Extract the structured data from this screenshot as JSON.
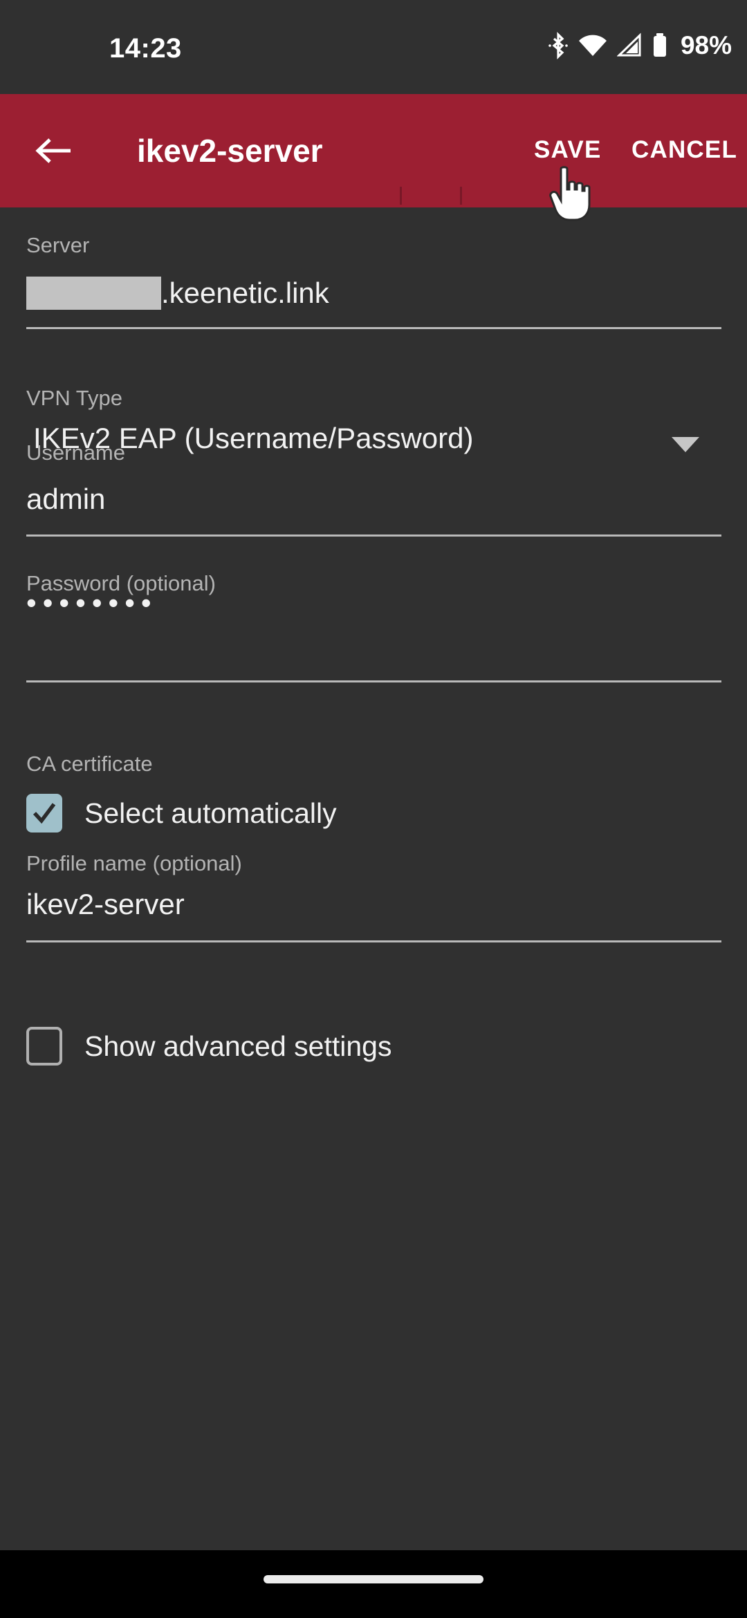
{
  "statusbar": {
    "time": "14:23",
    "battery_percent": "98%",
    "icons": [
      "bluetooth-icon",
      "wifi-icon",
      "cellular-signal-icon",
      "battery-icon"
    ]
  },
  "appbar": {
    "back_icon": "back-arrow-icon",
    "title": "ikev2-server",
    "save_label": "SAVE",
    "cancel_label": "CANCEL",
    "background_color": "#9c1f32",
    "text_color": "#ffffff"
  },
  "form": {
    "server": {
      "label": "Server",
      "redacted": true,
      "value_suffix": ".keenetic.link"
    },
    "vpn_type": {
      "label": "VPN Type",
      "value": "IKEv2 EAP (Username/Password)",
      "caret_icon": "chevron-down-icon"
    },
    "username": {
      "label": "Username",
      "value": "admin"
    },
    "password": {
      "label": "Password (optional)",
      "value": "••••••••",
      "masked": true
    },
    "ca_certificate": {
      "label": "CA certificate",
      "checkbox_label": "Select automatically",
      "checked": true,
      "checkbox_color": "#9fc0ca"
    },
    "profile_name": {
      "label": "Profile name (optional)",
      "value": "ikev2-server"
    },
    "advanced": {
      "checkbox_label": "Show advanced settings",
      "checked": false
    }
  },
  "navbar": {
    "gesture_pill": "home-gesture-pill"
  },
  "theme": {
    "background": "#303030",
    "label_color": "#b4b4b4",
    "value_color": "#f2f2f2",
    "underline_color": "#b9b9b9"
  }
}
